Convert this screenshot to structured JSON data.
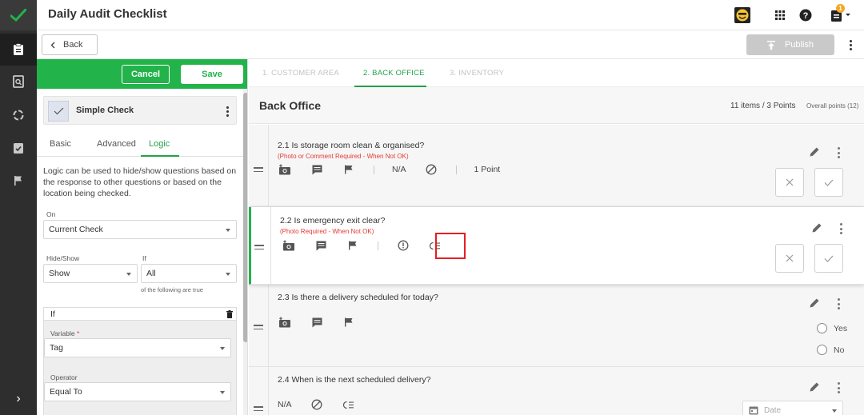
{
  "app": {
    "title": "Daily Audit Checklist",
    "notification_count": "1",
    "back_label": "Back",
    "publish_label": "Publish"
  },
  "nav": {
    "icons": [
      "clipboard-icon",
      "search-doc-icon",
      "ring-icon",
      "clipboard-check-icon",
      "flag-icon"
    ],
    "expand": "›"
  },
  "panel": {
    "cancel_label": "Cancel",
    "save_label": "Save",
    "question_type": "Simple Check",
    "tabs": [
      "Basic",
      "Advanced",
      "Logic"
    ],
    "active_tab": "Logic",
    "description": "Logic can be used to hide/show questions based on the response to other questions or based on the location being checked.",
    "on_label": "On",
    "on_value": "Current Check",
    "hideshow_label": "Hide/Show",
    "hideshow_value": "Show",
    "if_label": "If",
    "if_value": "All",
    "if_note": "of the following are true",
    "if_block_label": "If",
    "variable_label": "Variable",
    "variable_required": "*",
    "variable_value": "Tag",
    "operator_label": "Operator",
    "operator_value": "Equal To"
  },
  "main": {
    "steps": [
      "1. CUSTOMER AREA",
      "2. BACK OFFICE",
      "3. INVENTORY"
    ],
    "active_step": "2. BACK OFFICE",
    "section_title": "Back Office",
    "items_summary": "11 items / 3 Points",
    "overall_points": "Overall points (12)",
    "questions": [
      {
        "title": "2.1  Is storage room clean & organised?",
        "requirement": "(Photo or Comment Required - When Not OK)",
        "na": "N/A",
        "points": "1  Point"
      },
      {
        "title": "2.2  Is emergency exit clear?",
        "requirement": "(Photo Required - When Not OK)"
      },
      {
        "title": "2.3  Is there a delivery scheduled for today?",
        "options": [
          "Yes",
          "No"
        ]
      },
      {
        "title": "2.4  When is the next scheduled delivery?",
        "na": "N/A",
        "date_placeholder": "Date"
      }
    ]
  },
  "colors": {
    "accent_green": "#22b34a",
    "highlight_red": "#e31e24",
    "required_red": "#e53935"
  }
}
